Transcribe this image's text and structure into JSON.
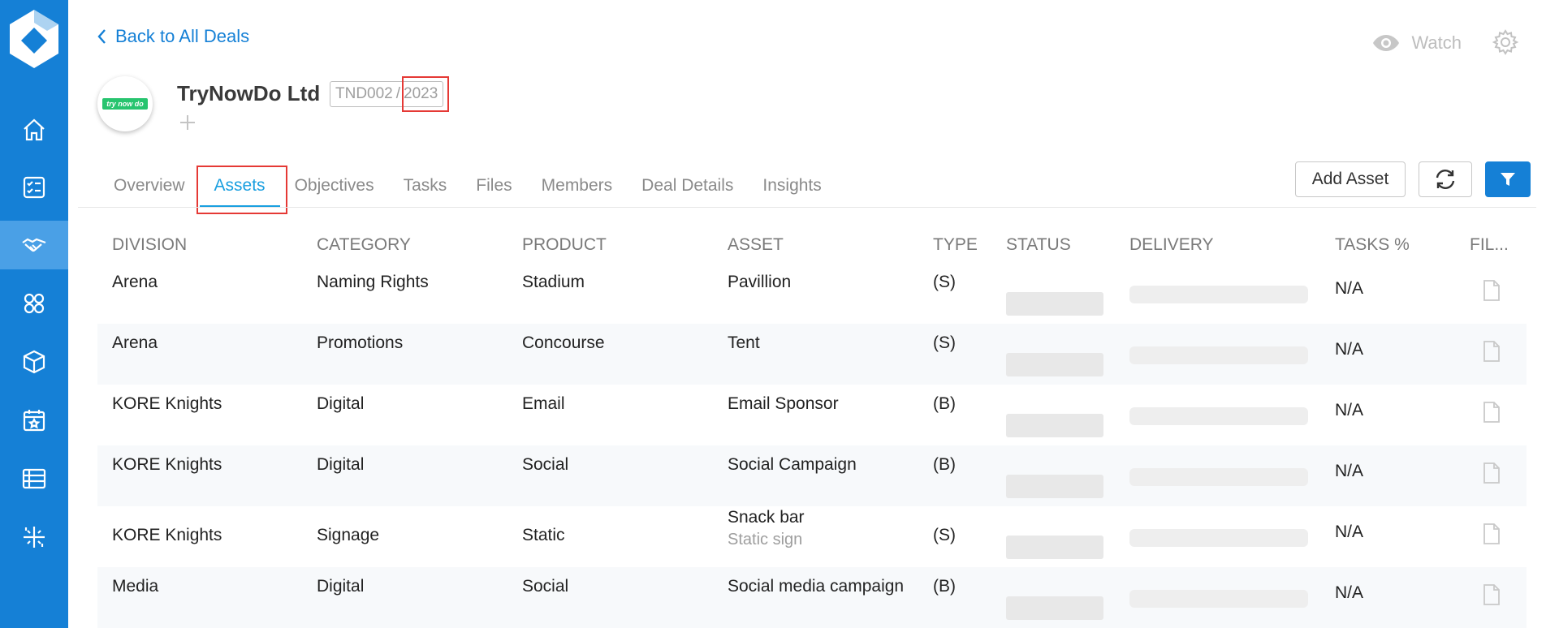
{
  "colors": {
    "sidebar": "#1580d6",
    "accent": "#1a9fe0",
    "highlight": "#e53935"
  },
  "sidebar": {
    "items": [
      {
        "icon": "home-icon"
      },
      {
        "icon": "checklist-icon"
      },
      {
        "icon": "handshake-icon",
        "active": true
      },
      {
        "icon": "people-icon"
      },
      {
        "icon": "box-icon"
      },
      {
        "icon": "calendar-star-icon"
      },
      {
        "icon": "table-list-icon"
      },
      {
        "icon": "sparkles-icon"
      }
    ]
  },
  "header": {
    "back_label": "Back to All Deals",
    "watch_label": "Watch",
    "company_name": "TryNowDo Ltd",
    "company_logo_text": "try now do",
    "deal_code": "TND002",
    "code_separator": "/",
    "deal_year": "2023"
  },
  "tabs": [
    {
      "label": "Overview"
    },
    {
      "label": "Assets",
      "active": true
    },
    {
      "label": "Objectives"
    },
    {
      "label": "Tasks"
    },
    {
      "label": "Files"
    },
    {
      "label": "Members"
    },
    {
      "label": "Deal Details"
    },
    {
      "label": "Insights"
    }
  ],
  "toolbar": {
    "add_asset_label": "Add Asset"
  },
  "table": {
    "columns": [
      "DIVISION",
      "CATEGORY",
      "PRODUCT",
      "ASSET",
      "TYPE",
      "STATUS",
      "DELIVERY",
      "TASKS %",
      "FIL..."
    ],
    "rows": [
      {
        "division": "Arena",
        "category": "Naming Rights",
        "product": "Stadium",
        "asset": "Pavillion",
        "asset_sub": "",
        "type": "(S)",
        "tasks": "N/A"
      },
      {
        "division": "Arena",
        "category": "Promotions",
        "product": "Concourse",
        "asset": "Tent",
        "asset_sub": "",
        "type": "(S)",
        "tasks": "N/A"
      },
      {
        "division": "KORE Knights",
        "category": "Digital",
        "product": "Email",
        "asset": "Email Sponsor",
        "asset_sub": "",
        "type": "(B)",
        "tasks": "N/A"
      },
      {
        "division": "KORE Knights",
        "category": "Digital",
        "product": "Social",
        "asset": "Social Campaign",
        "asset_sub": "",
        "type": "(B)",
        "tasks": "N/A"
      },
      {
        "division": "KORE Knights",
        "category": "Signage",
        "product": "Static",
        "asset": "Snack bar",
        "asset_sub": "Static sign",
        "type": "(S)",
        "tasks": "N/A"
      },
      {
        "division": "Media",
        "category": "Digital",
        "product": "Social",
        "asset": "Social media campaign",
        "asset_sub": "",
        "type": "(B)",
        "tasks": "N/A"
      }
    ]
  }
}
